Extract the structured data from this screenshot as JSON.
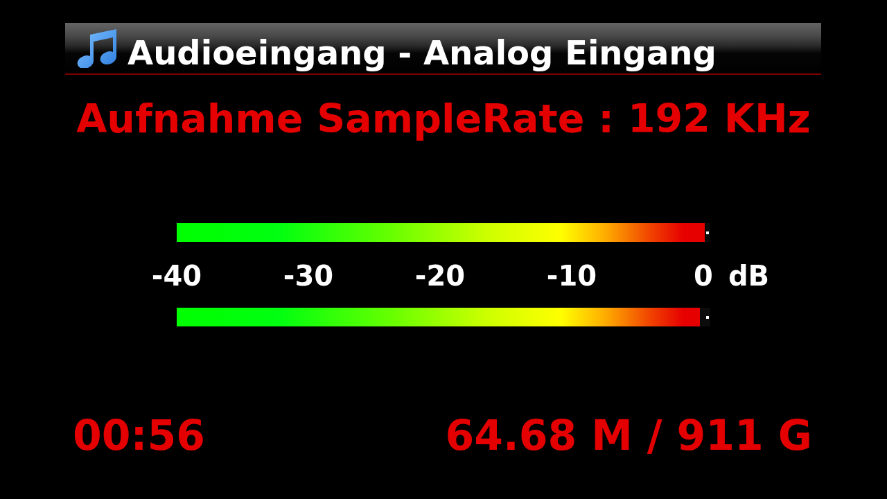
{
  "title_bar": {
    "title": "Audioeingang - Analog Eingang"
  },
  "sample_rate": "Aufnahme SampleRate : 192 KHz",
  "meters": [
    {
      "level": 0.99
    },
    {
      "level": 0.98
    }
  ],
  "scale": {
    "labels": [
      "-40",
      "-30",
      "-20",
      "-10",
      "0"
    ],
    "unit": "dB"
  },
  "status": {
    "elapsed": "00:56",
    "storage": "64.68 M / 911 G"
  }
}
